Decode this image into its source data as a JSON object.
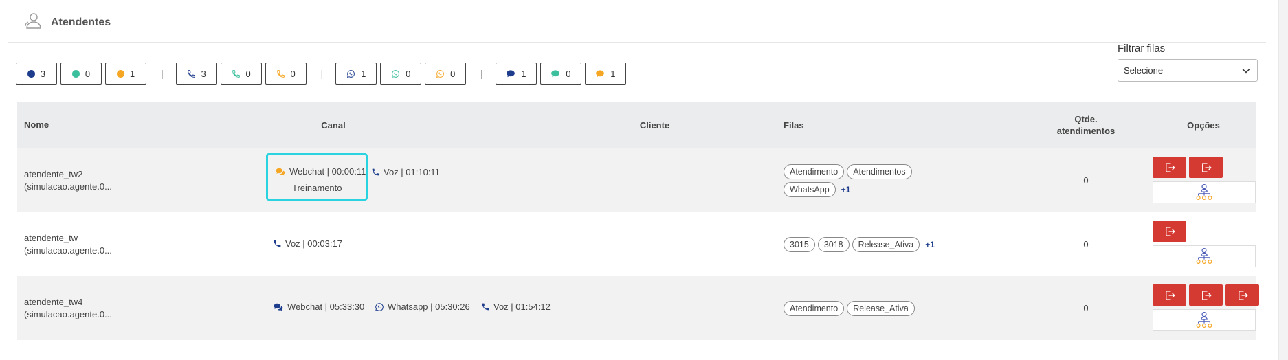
{
  "header": {
    "title": "Atendentes"
  },
  "counters": {
    "status": [
      {
        "icon": "blue-dot-icon",
        "color": "#1d3c8c",
        "value": "3"
      },
      {
        "icon": "green-dot-icon",
        "color": "#3cbf9c",
        "value": "0"
      },
      {
        "icon": "orange-dot-icon",
        "color": "#f5a623",
        "value": "1"
      }
    ],
    "voz": [
      {
        "icon": "phone-icon",
        "color": "#1d3c8c",
        "value": "3"
      },
      {
        "icon": "phone-icon",
        "color": "#3cbf9c",
        "value": "0"
      },
      {
        "icon": "phone-icon",
        "color": "#f5a623",
        "value": "0"
      }
    ],
    "whatsapp": [
      {
        "icon": "whatsapp-icon",
        "color": "#1d3c8c",
        "value": "1"
      },
      {
        "icon": "whatsapp-icon",
        "color": "#3cbf9c",
        "value": "0"
      },
      {
        "icon": "whatsapp-icon",
        "color": "#f5a623",
        "value": "0"
      }
    ],
    "webchat": [
      {
        "icon": "chat-icon",
        "color": "#1d3c8c",
        "value": "1"
      },
      {
        "icon": "chat-icon",
        "color": "#3cbf9c",
        "value": "0"
      },
      {
        "icon": "chat-icon",
        "color": "#f5a623",
        "value": "1"
      }
    ],
    "separator": "|"
  },
  "filter": {
    "label": "Filtrar filas",
    "selected": "Selecione"
  },
  "table": {
    "headers": {
      "nome": "Nome",
      "canal": "Canal",
      "cliente": "Cliente",
      "filas": "Filas",
      "qtde_1": "Qtde.",
      "qtde_2": "atendimentos",
      "opcoes": "Opções"
    },
    "rows": [
      {
        "nome_1": "atendente_tw2",
        "nome_2": "(simulacao.agente.0...",
        "canais": [
          {
            "icon": "webchat-icon",
            "text": "Webchat | 00:00:11",
            "sub": "Treinamento"
          },
          {
            "icon": "phone-icon",
            "text": "Voz | 01:10:11"
          }
        ],
        "filas": [
          "Atendimento",
          "Atendimentos",
          "WhatsApp"
        ],
        "filas_extra": "+1",
        "qtde": "0"
      },
      {
        "nome_1": "atendente_tw",
        "nome_2": "(simulacao.agente.0...",
        "canais": [
          {
            "icon": "phone-icon",
            "text": "Voz | 00:03:17"
          }
        ],
        "filas": [
          "3015",
          "3018",
          "Release_Ativa"
        ],
        "filas_extra": "+1",
        "qtde": "0"
      },
      {
        "nome_1": "atendente_tw4",
        "nome_2": "(simulacao.agente.0...",
        "canais": [
          {
            "icon": "webchat-icon",
            "text": "Webchat | 05:33:30"
          },
          {
            "icon": "whatsapp-icon",
            "text": "Whatsapp | 05:30:26"
          },
          {
            "icon": "phone-icon",
            "text": "Voz | 01:54:12"
          }
        ],
        "filas": [
          "Atendimento",
          "Release_Ativa"
        ],
        "qtde": "0"
      }
    ]
  },
  "colors": {
    "logout_button": "#d43a32",
    "highlight": "#29d4e0",
    "navy": "#1d3c8c",
    "orange": "#f5a623",
    "green": "#3cbf9c"
  }
}
